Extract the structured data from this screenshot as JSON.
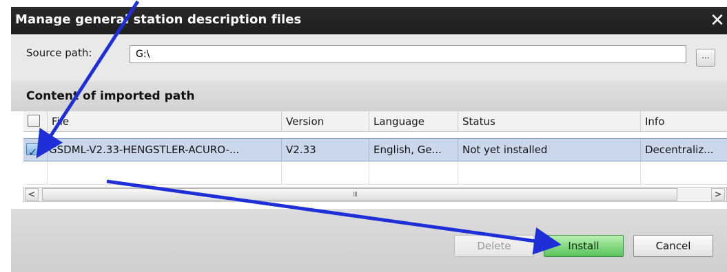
{
  "window": {
    "title": "Manage general station description files",
    "close_glyph": "✕"
  },
  "source": {
    "label": "Source path:",
    "value": "G:\\",
    "browse_label": "..."
  },
  "section": {
    "title": "Content of imported path"
  },
  "table": {
    "columns": [
      "File",
      "Version",
      "Language",
      "Status",
      "Info"
    ],
    "rows": [
      {
        "checked": true,
        "file": "GSDML-V2.33-HENGSTLER-ACURO-...",
        "version": "V2.33",
        "language": "English, Ge...",
        "status": "Not yet installed",
        "info": "Decentraliz..."
      }
    ]
  },
  "scrollbar": {
    "left_arrow": "<",
    "right_arrow": ">",
    "grip": "III"
  },
  "buttons": {
    "delete": "Delete",
    "install": "Install",
    "cancel": "Cancel"
  },
  "colors": {
    "titlebar": "#1e1e1e",
    "selected_row": "#cad6ea",
    "install_button": "#59c45a",
    "annotation_arrow": "#1f2fd8"
  },
  "icons": [
    "close-icon",
    "browse-icon",
    "checkbox-icon",
    "scroll-left-icon",
    "scroll-right-icon",
    "annotation-arrow-icon"
  ]
}
